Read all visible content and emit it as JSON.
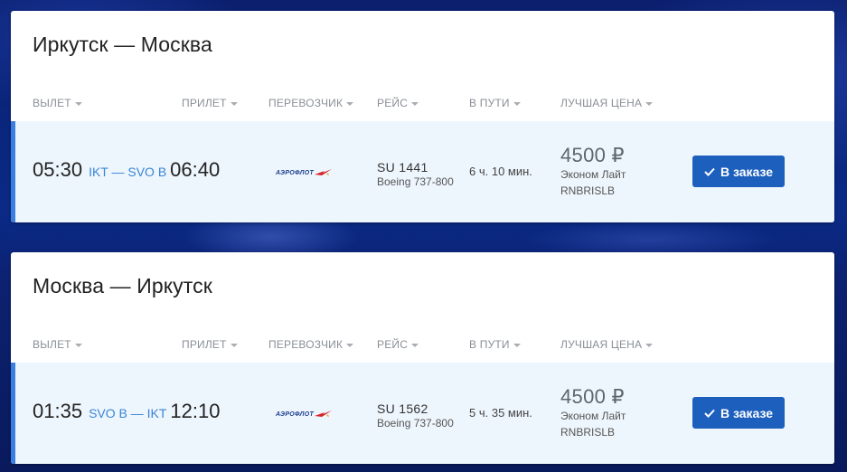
{
  "columns": {
    "departure": "ВЫЛЕТ",
    "arrival": "ПРИЛЕТ",
    "carrier": "ПЕРЕВОЗЧИК",
    "flight": "РЕЙС",
    "duration": "В ПУТИ",
    "best_price": "ЛУЧШАЯ ЦЕНА"
  },
  "trips": [
    {
      "route_title": "Иркутск — Москва",
      "dep_time": "05:30",
      "airports": "IKT — SVO B",
      "arr_time": "06:40",
      "carrier_logo_text": "АЭРОФЛОТ",
      "flight_number": "SU 1441",
      "aircraft": "Boeing 737-800",
      "duration": "6 ч. 10 мин.",
      "price": "4500 ₽",
      "fare_name": "Эконом Лайт",
      "fare_code": "RNBRISLB",
      "button_label": "В заказе"
    },
    {
      "route_title": "Москва — Иркутск",
      "dep_time": "01:35",
      "airports": "SVO B — IKT",
      "arr_time": "12:10",
      "carrier_logo_text": "АЭРОФЛОТ",
      "flight_number": "SU 1562",
      "aircraft": "Boeing 737-800",
      "duration": "5 ч. 35 мин.",
      "price": "4500 ₽",
      "fare_name": "Эконом Лайт",
      "fare_code": "RNBRISLB",
      "button_label": "В заказе"
    }
  ],
  "colors": {
    "accent_blue": "#1d5fbd",
    "row_bg": "#eef6fd",
    "row_border": "#3a7ee0",
    "airport_codes": "#3a84d6"
  },
  "icons": {
    "button": "check-icon",
    "sort": "caret-down-icon",
    "carrier": "aeroflot-logo"
  }
}
